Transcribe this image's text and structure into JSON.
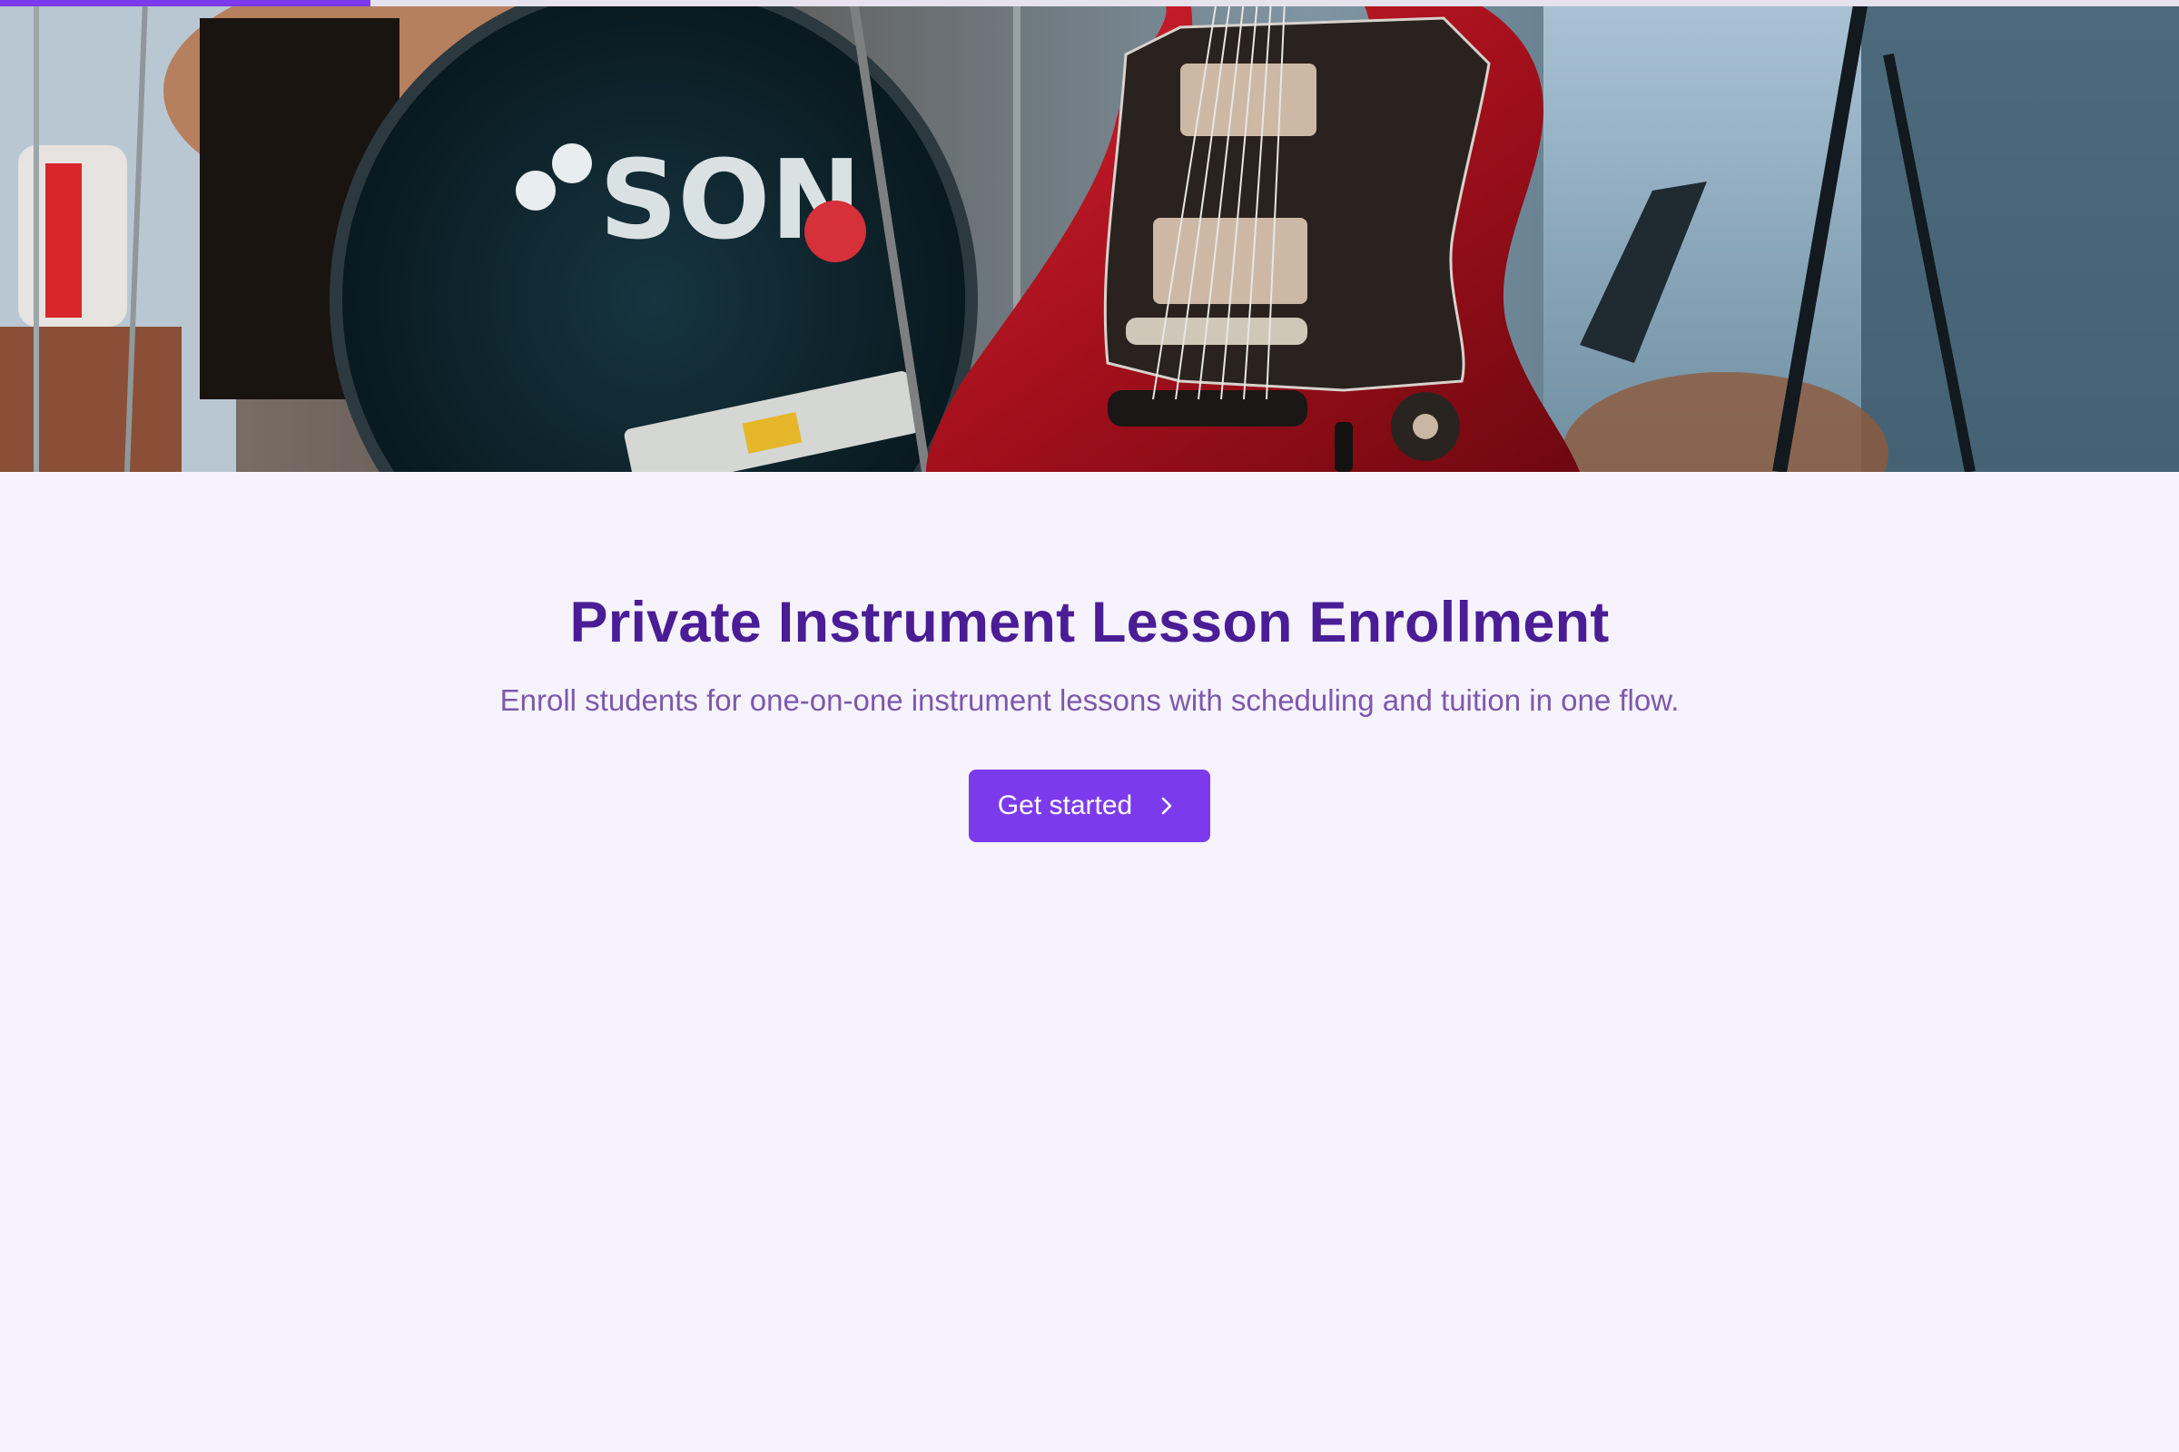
{
  "progress": {
    "value_percent": 17
  },
  "hero": {
    "alt": "Red electric guitar in front of a drum kit"
  },
  "main": {
    "title": "Private Instrument Lesson Enrollment",
    "subtitle": "Enroll students for one-on-one instrument lessons with scheduling and tuition in one flow.",
    "cta_label": "Get started",
    "cta_icon": "chevron-right-icon"
  },
  "colors": {
    "accent": "#7c3aed",
    "title": "#4a1d96",
    "subtitle": "#7d58ad",
    "background": "#f6f3fd"
  }
}
